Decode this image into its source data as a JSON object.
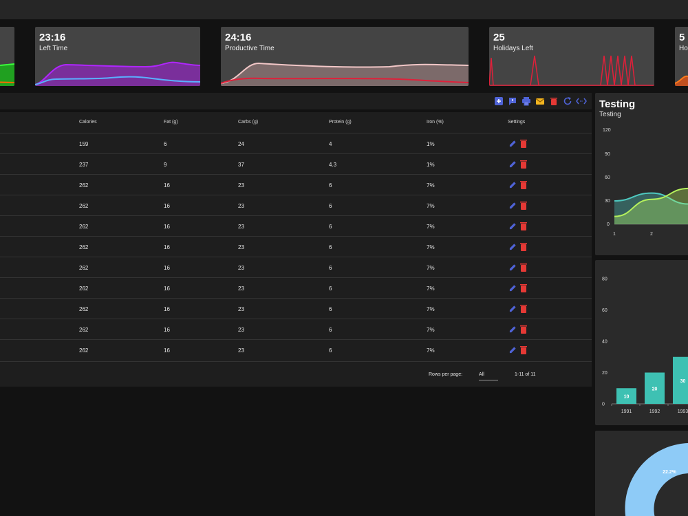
{
  "stat_cards": [
    {
      "value": "",
      "label": ""
    },
    {
      "value": "23:16",
      "label": "Left Time"
    },
    {
      "value": "24:16",
      "label": "Productive Time"
    },
    {
      "value": "25",
      "label": "Holidays Left"
    },
    {
      "value": "5",
      "label": "Ho"
    }
  ],
  "toolbar": {
    "icons": [
      "add-box-icon",
      "feedback-icon",
      "print-icon",
      "email-icon",
      "delete-icon",
      "refresh-icon",
      "code-icon"
    ],
    "colors": {
      "blue": "#4f63d6",
      "yellow": "#f3b520",
      "red": "#e53935"
    }
  },
  "table": {
    "headers": {
      "calories": "Calories",
      "fat": "Fat (g)",
      "carbs": "Carbs (g)",
      "protein": "Protein (g)",
      "iron": "Iron (%)",
      "settings": "Settings"
    },
    "rows": [
      {
        "calories": "159",
        "fat": "6",
        "carbs": "24",
        "protein": "4",
        "iron": "1%"
      },
      {
        "calories": "237",
        "fat": "9",
        "carbs": "37",
        "protein": "4.3",
        "iron": "1%"
      },
      {
        "calories": "262",
        "fat": "16",
        "carbs": "23",
        "protein": "6",
        "iron": "7%"
      },
      {
        "calories": "262",
        "fat": "16",
        "carbs": "23",
        "protein": "6",
        "iron": "7%"
      },
      {
        "calories": "262",
        "fat": "16",
        "carbs": "23",
        "protein": "6",
        "iron": "7%"
      },
      {
        "calories": "262",
        "fat": "16",
        "carbs": "23",
        "protein": "6",
        "iron": "7%"
      },
      {
        "calories": "262",
        "fat": "16",
        "carbs": "23",
        "protein": "6",
        "iron": "7%"
      },
      {
        "calories": "262",
        "fat": "16",
        "carbs": "23",
        "protein": "6",
        "iron": "7%"
      },
      {
        "calories": "262",
        "fat": "16",
        "carbs": "23",
        "protein": "6",
        "iron": "7%"
      },
      {
        "calories": "262",
        "fat": "16",
        "carbs": "23",
        "protein": "6",
        "iron": "7%"
      },
      {
        "calories": "262",
        "fat": "16",
        "carbs": "23",
        "protein": "6",
        "iron": "7%"
      }
    ],
    "pagination": {
      "rows_per_page_label": "Rows per page:",
      "rows_per_page_value": "All",
      "range": "1-11 of 11"
    }
  },
  "line_card": {
    "title": "Testing",
    "subtitle": "Testing",
    "y_ticks": [
      "120",
      "90",
      "60",
      "30",
      "0"
    ],
    "x_ticks": [
      "1",
      "2"
    ]
  },
  "chart_data": [
    {
      "type": "area",
      "title": "Testing",
      "x": [
        1,
        2,
        3
      ],
      "ylim": [
        0,
        120
      ],
      "series": [
        {
          "color": "#4ec9c0",
          "values": [
            30,
            40,
            26
          ]
        },
        {
          "color": "#b6f25c",
          "values": [
            10,
            32,
            46
          ]
        }
      ]
    },
    {
      "type": "bar",
      "categories": [
        "1991",
        "1992",
        "1993"
      ],
      "values": [
        10,
        20,
        30
      ],
      "ylim": [
        0,
        80
      ],
      "y_ticks": [
        "80",
        "60",
        "40",
        "20",
        "0"
      ],
      "color": "#3ec1b3"
    },
    {
      "type": "pie",
      "slices": [
        {
          "label": "22.2%",
          "value": 22.2,
          "color": "#8ecbf7"
        }
      ]
    }
  ]
}
